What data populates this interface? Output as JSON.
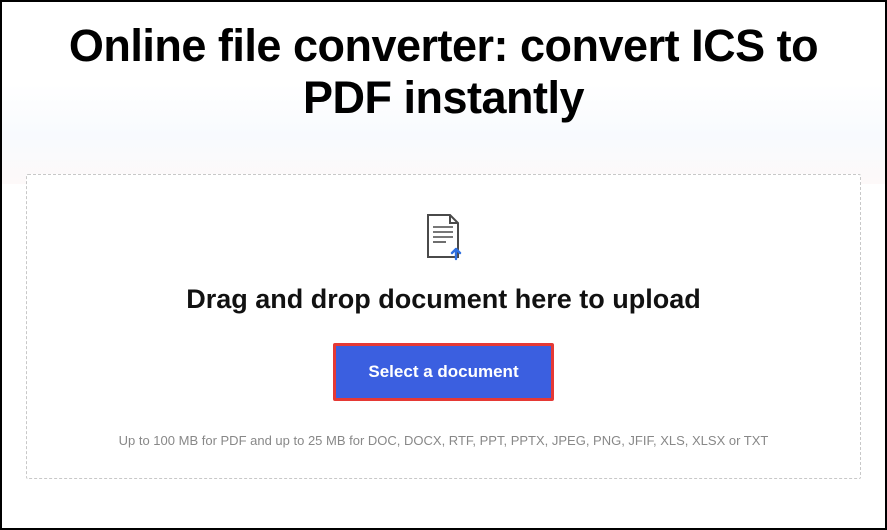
{
  "hero": {
    "title": "Online file converter: convert ICS to PDF instantly"
  },
  "upload": {
    "drop_text": "Drag and drop document here to upload",
    "button_label": "Select a document",
    "limits_text": "Up to 100 MB for PDF and up to 25 MB for DOC, DOCX, RTF, PPT, PPTX, JPEG, PNG, JFIF, XLS, XLSX or TXT"
  }
}
